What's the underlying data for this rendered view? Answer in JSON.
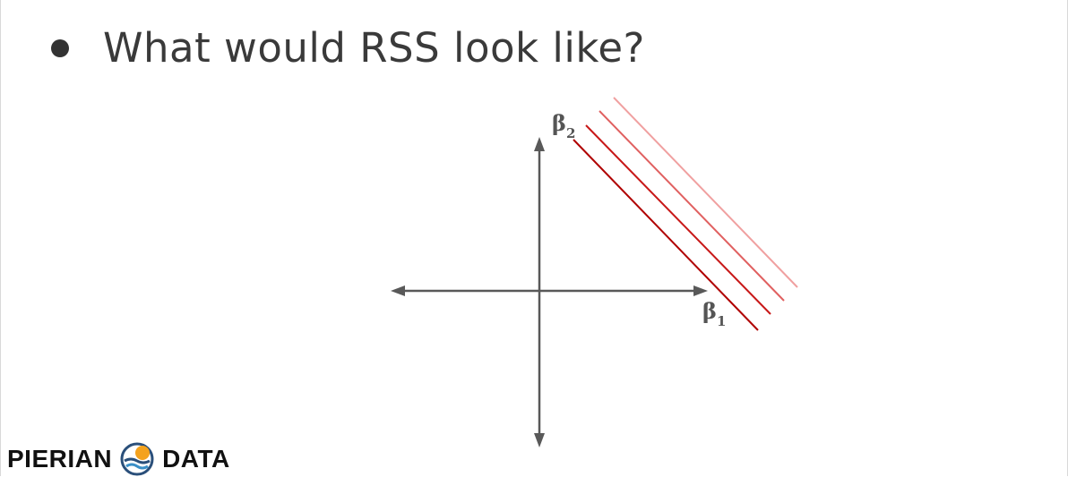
{
  "slide": {
    "bullet_text": "What would RSS look like?"
  },
  "diagram": {
    "y_axis_label": "β",
    "y_axis_subscript": "2",
    "x_axis_label": "β",
    "x_axis_subscript": "1",
    "contour_colors": [
      "#b00000",
      "#dd5555",
      "#ee9999"
    ],
    "axis_color": "#595959"
  },
  "logo": {
    "left_word": "PIERIAN",
    "right_word": "DATA",
    "icon": "pierian-data-logo-icon"
  }
}
